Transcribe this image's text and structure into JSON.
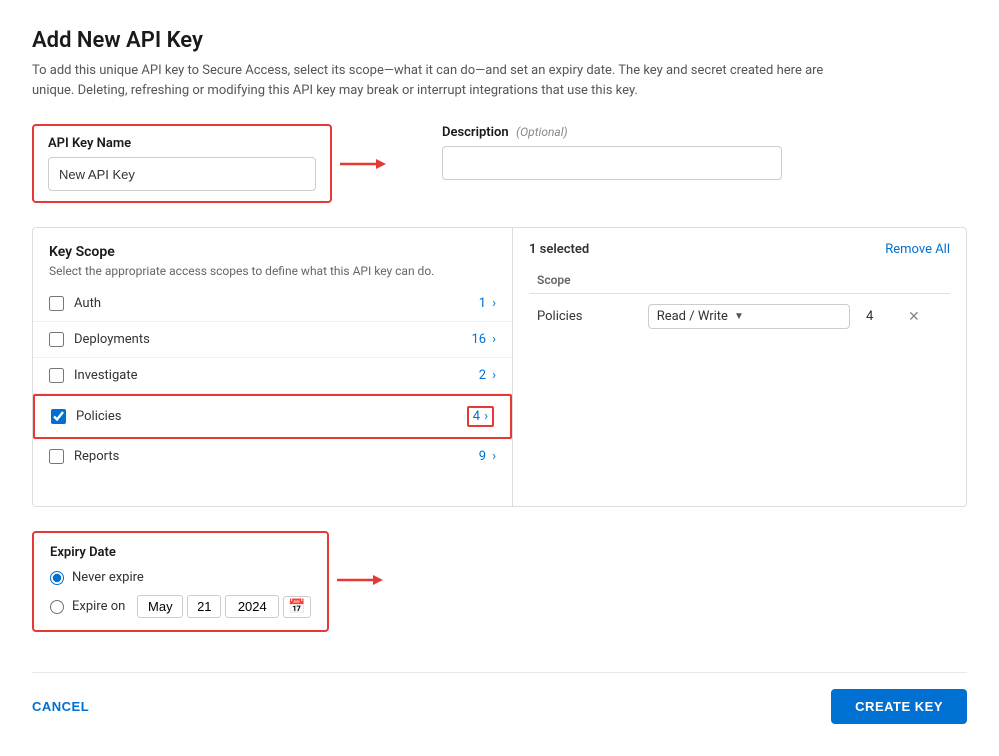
{
  "page": {
    "title": "Add New API Key",
    "description": "To add this unique API key to Secure Access, select its scope—what it can do—and set an expiry date. The key and secret created here are unique. Deleting, refreshing or modifying this API key may break or interrupt integrations that use this key."
  },
  "form": {
    "api_key_name": {
      "label": "API Key Name",
      "value": "New API Key",
      "placeholder": "New API Key"
    },
    "description": {
      "label": "Description",
      "optional_label": "(Optional)",
      "value": "",
      "placeholder": ""
    }
  },
  "scope": {
    "title": "Key Scope",
    "subtitle": "Select the appropriate access scopes to define what this API key can do.",
    "items": [
      {
        "name": "Auth",
        "count": "1",
        "checked": false
      },
      {
        "name": "Deployments",
        "count": "16",
        "checked": false
      },
      {
        "name": "Investigate",
        "count": "2",
        "checked": false
      },
      {
        "name": "Policies",
        "count": "4",
        "checked": true
      },
      {
        "name": "Reports",
        "count": "9",
        "checked": false
      }
    ]
  },
  "selected": {
    "count_label": "1 selected",
    "remove_all_label": "Remove All",
    "column_header": "Scope",
    "rows": [
      {
        "scope_name": "Policies",
        "permission": "Read / Write",
        "count": "4"
      }
    ]
  },
  "expiry": {
    "title": "Expiry Date",
    "options": [
      {
        "label": "Never expire",
        "value": "never",
        "selected": true
      },
      {
        "label": "Expire on",
        "value": "date",
        "selected": false
      }
    ],
    "date": {
      "month": "May",
      "day": "21",
      "year": "2024"
    }
  },
  "actions": {
    "cancel_label": "CANCEL",
    "create_label": "CREATE KEY"
  }
}
